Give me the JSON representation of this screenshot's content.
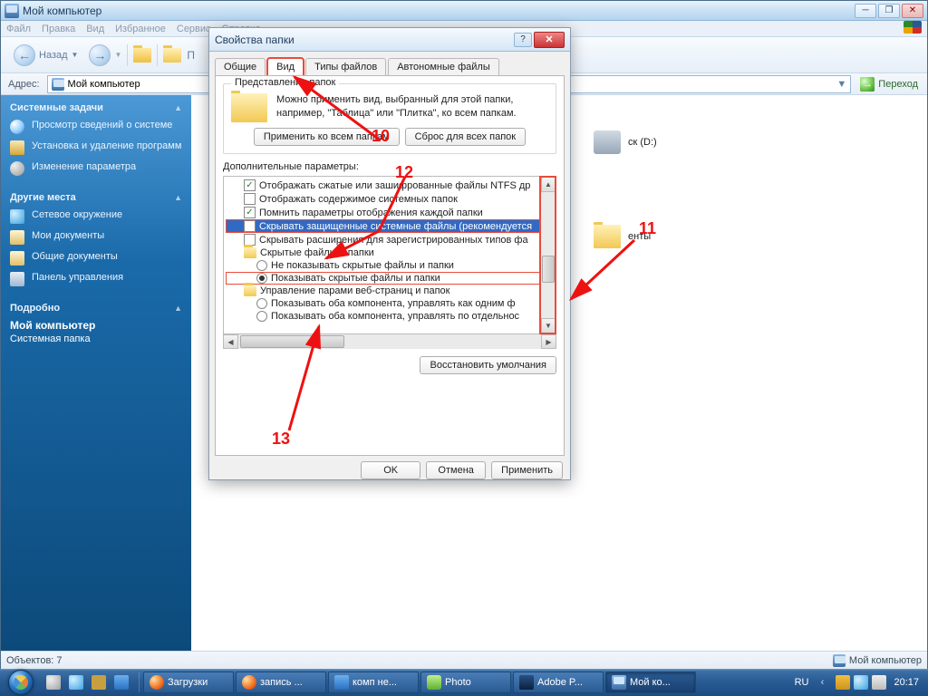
{
  "main_window": {
    "title": "Мой компьютер",
    "menu": [
      "Файл",
      "Правка",
      "Вид",
      "Избранное",
      "Сервис",
      "Справка"
    ],
    "nav": {
      "back": "Назад"
    },
    "address": {
      "label": "Адрес:",
      "value": "Мой компьютер",
      "go": "Переход"
    },
    "sidebar": {
      "tasks": {
        "title": "Системные задачи",
        "items": [
          "Просмотр сведений о системе",
          "Установка и удаление программ",
          "Изменение параметра"
        ]
      },
      "places": {
        "title": "Другие места",
        "items": [
          "Сетевое окружение",
          "Мои документы",
          "Общие документы",
          "Панель управления"
        ]
      },
      "details": {
        "title": "Подробно",
        "name": "Мой компьютер",
        "type": "Системная папка"
      }
    },
    "content": {
      "visible_items": [
        "ск (D:)",
        "енты"
      ]
    },
    "statusbar": {
      "left": "Объектов: 7",
      "right": "Мой компьютер"
    }
  },
  "dialog": {
    "title": "Свойства папки",
    "tabs": [
      "Общие",
      "Вид",
      "Типы файлов",
      "Автономные файлы"
    ],
    "active_tab": 1,
    "view_group": {
      "legend": "Представление папок",
      "text1": "Можно применить вид, выбранный для этой папки,",
      "text2": "например, \"Таблица\" или \"Плитка\", ко всем папкам.",
      "apply_all": "Применить ко всем папкам",
      "reset_all": "Сброс для всех папок"
    },
    "advanced_label": "Дополнительные параметры:",
    "tree": [
      {
        "type": "checkbox",
        "checked": true,
        "indent": 1,
        "label": "Отображать сжатые или зашифрованные файлы NTFS др"
      },
      {
        "type": "checkbox",
        "checked": false,
        "indent": 1,
        "label": "Отображать содержимое системных папок"
      },
      {
        "type": "checkbox",
        "checked": true,
        "indent": 1,
        "label": "Помнить параметры отображения каждой папки"
      },
      {
        "type": "checkbox",
        "checked": false,
        "indent": 1,
        "label": "Скрывать защищенные системные файлы (рекомендуется",
        "selected": true,
        "highlight": true
      },
      {
        "type": "checkbox",
        "checked": false,
        "indent": 1,
        "label": "Скрывать расширения для зарегистрированных типов фа"
      },
      {
        "type": "folder",
        "indent": 1,
        "label": "Скрытые файлы и папки"
      },
      {
        "type": "radio",
        "checked": false,
        "indent": 2,
        "label": "Не показывать скрытые файлы и папки"
      },
      {
        "type": "radio",
        "checked": true,
        "indent": 2,
        "label": "Показывать скрытые файлы и папки",
        "highlight": true
      },
      {
        "type": "folder",
        "indent": 1,
        "label": "Управление парами веб-страниц и папок"
      },
      {
        "type": "radio",
        "checked": false,
        "indent": 2,
        "label": "Показывать оба компонента, управлять как одним ф"
      },
      {
        "type": "radio",
        "checked": false,
        "indent": 2,
        "label": "Показывать оба компонента, управлять по отдельнос"
      }
    ],
    "restore": "Восстановить умолчания",
    "buttons": {
      "ok": "OK",
      "cancel": "Отмена",
      "apply": "Применить"
    }
  },
  "annotations": {
    "a10": "10",
    "a11": "11",
    "a12": "12",
    "a13": "13"
  },
  "taskbar": {
    "tasks": [
      {
        "label": "Загрузки",
        "icon": "ic-ff"
      },
      {
        "label": "запись ...",
        "icon": "ic-ff"
      },
      {
        "label": "комп не...",
        "icon": "ic-word"
      },
      {
        "label": "Photo",
        "icon": "ic-photo"
      },
      {
        "label": "Adobe P...",
        "icon": "ic-ps"
      },
      {
        "label": "Мой ко...",
        "icon": "comp-icon",
        "active": true
      }
    ],
    "lang": "RU",
    "time": "20:17"
  }
}
